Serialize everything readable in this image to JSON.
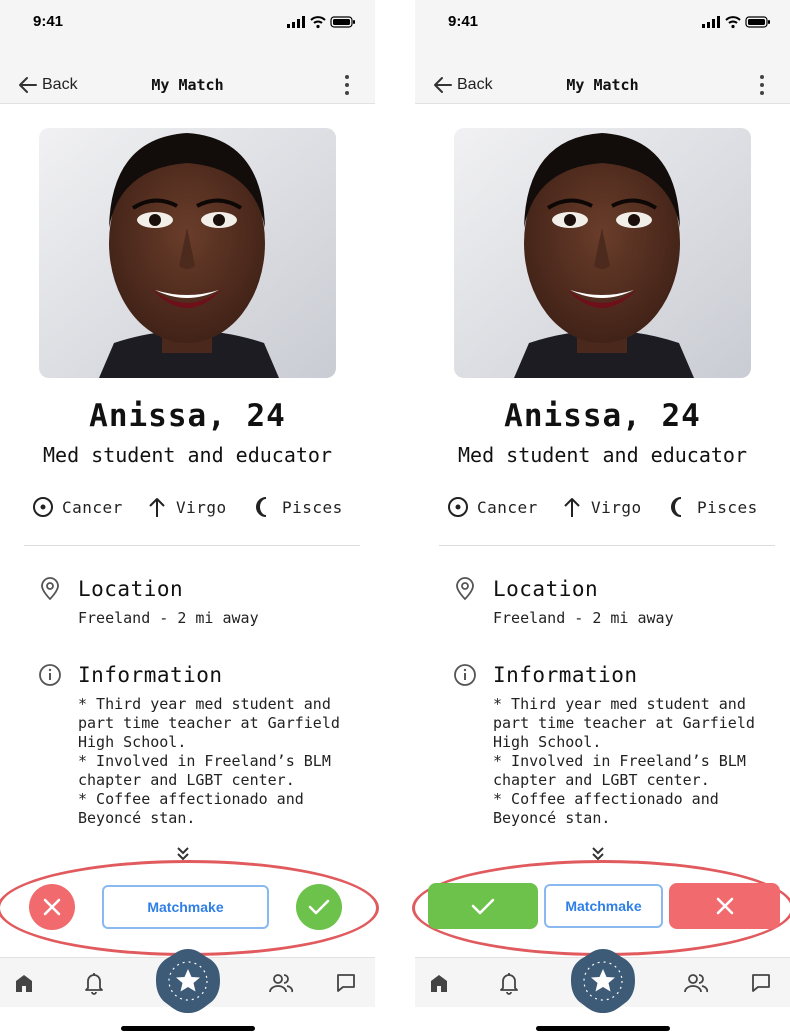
{
  "screens": [
    {
      "id": "a",
      "status": {
        "time": "9:41"
      },
      "nav": {
        "back_label": "Back",
        "title": "My Match"
      },
      "profile": {
        "name": "Anissa, 24",
        "tagline": "Med student and educator",
        "signs": [
          {
            "label": "Cancer",
            "icon": "sun-sign-icon"
          },
          {
            "label": "Virgo",
            "icon": "rising-sign-icon"
          },
          {
            "label": "Pisces",
            "icon": "moon-sign-icon"
          }
        ]
      },
      "location": {
        "title": "Location",
        "text": "Freeland - 2 mi away"
      },
      "information": {
        "title": "Information",
        "text": "* Third year med student and\npart time teacher at Garfield\nHigh School.\n* Involved in Freeland’s BLM\nchapter and LGBT center.\n* Coffee affectionado and\nBeyoncé stan."
      },
      "actions": {
        "matchmake_label": "Matchmake",
        "layout": "round",
        "order": [
          "reject",
          "matchmake",
          "accept"
        ]
      }
    },
    {
      "id": "b",
      "status": {
        "time": "9:41"
      },
      "nav": {
        "back_label": "Back",
        "title": "My Match"
      },
      "profile": {
        "name": "Anissa, 24",
        "tagline": "Med student and educator",
        "signs": [
          {
            "label": "Cancer",
            "icon": "sun-sign-icon"
          },
          {
            "label": "Virgo",
            "icon": "rising-sign-icon"
          },
          {
            "label": "Pisces",
            "icon": "moon-sign-icon"
          }
        ]
      },
      "location": {
        "title": "Location",
        "text": "Freeland - 2 mi away"
      },
      "information": {
        "title": "Information",
        "text": "* Third year med student and\npart time teacher at Garfield\nHigh School.\n* Involved in Freeland’s BLM\nchapter and LGBT center.\n* Coffee affectionado and\nBeyoncé stan."
      },
      "actions": {
        "matchmake_label": "Matchmake",
        "layout": "pill",
        "order": [
          "accept",
          "matchmake",
          "reject"
        ]
      }
    }
  ],
  "tabs": [
    {
      "icon": "home-icon"
    },
    {
      "icon": "bell-icon"
    },
    {
      "icon": "star-badge-icon"
    },
    {
      "icon": "people-icon"
    },
    {
      "icon": "chat-icon"
    }
  ],
  "colors": {
    "reject": "#f16b6e",
    "accept": "#6cc24a",
    "matchmake_border": "#8ab8f0",
    "matchmake_text": "#2f7fe6",
    "highlight": "#e05a5e",
    "tab_center": "#3d5a77"
  }
}
